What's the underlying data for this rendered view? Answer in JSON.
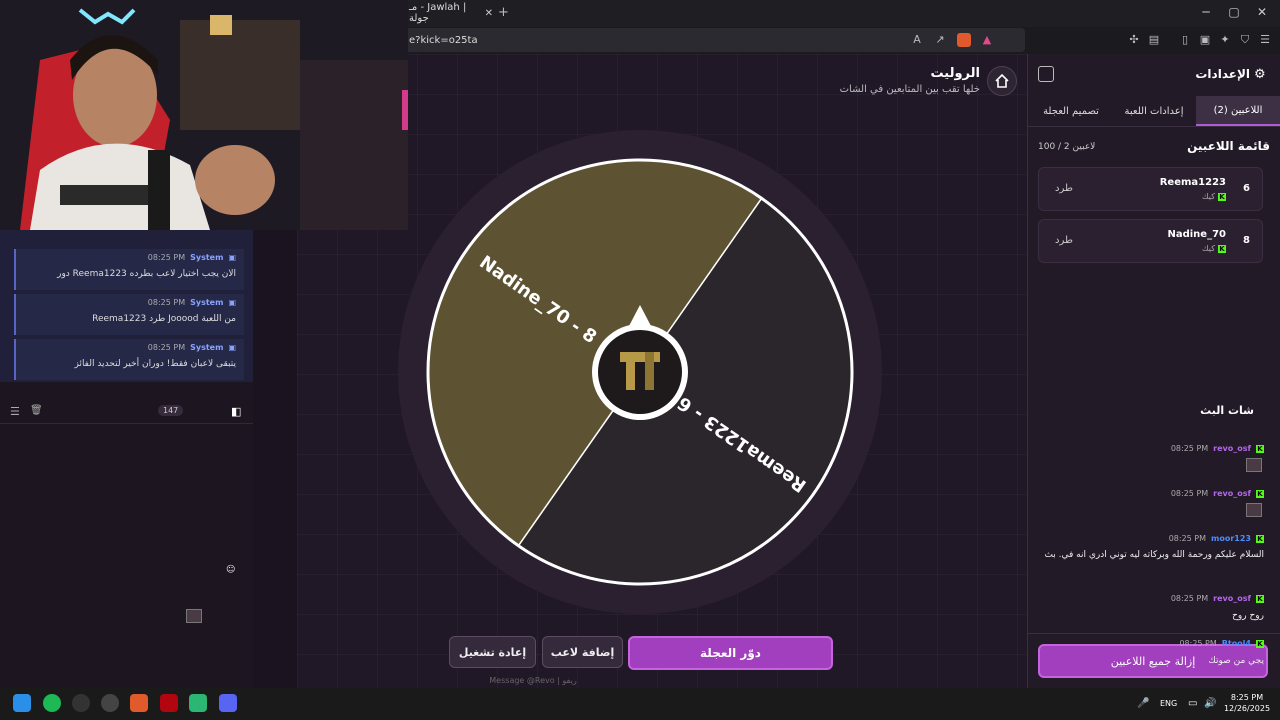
{
  "browser": {
    "tab_title": "مـ - Jawlah | جولة",
    "url": "e?kick=o25ta",
    "new_tab": "+",
    "minimize": "─",
    "maximize": "▢",
    "close": "✕",
    "tab_close": "✕"
  },
  "header": {
    "title": "الروليت",
    "subtitle": "خلها تقب بين المتابعين في الشات",
    "home_icon": "home-icon"
  },
  "wheel": {
    "segments": [
      {
        "label": "Reema1223 - 6",
        "value": 1,
        "color": "#2b252c"
      },
      {
        "label": "Nadine_70 - 8",
        "value": 1,
        "color": "#5d5232"
      }
    ],
    "start_angle_deg": -55
  },
  "actions": {
    "spin": "دوّر العجلة",
    "add_player": "إضافة لاعب",
    "restart": "إعادة تشغيل"
  },
  "settings": {
    "title": "الإعدادات",
    "tabs": [
      "اللاعبين (2)",
      "إعدادات اللعبة",
      "تصميم العجلة"
    ],
    "list_title": "قائمة اللاعبين",
    "count": "100 / 2 لاعبين",
    "players": [
      {
        "num": "6",
        "name": "Reema1223",
        "platform": "كيك",
        "kick": "طرد"
      },
      {
        "num": "8",
        "name": "Nadine_70",
        "platform": "كيك",
        "kick": "طرد"
      }
    ],
    "remove_all": "إزالة جميع اللاعبين"
  },
  "system_messages": [
    {
      "name": "System",
      "time": "08:25 PM",
      "text": "دور Reema1223 الان يجب اختيار لاعب بطرده"
    },
    {
      "name": "System",
      "time": "08:25 PM",
      "text": "Reema1223 طرد Jooood من اللعبة"
    },
    {
      "name": "System",
      "time": "08:25 PM",
      "text": "يتبقى لاعبان فقط! دوران أخير لتحديد الفائز"
    }
  ],
  "chat": {
    "title": "شات البث",
    "count": "147",
    "messages": [
      {
        "user": "revo_osf",
        "time": "08:25 PM",
        "text": "",
        "color": "#b368e8"
      },
      {
        "user": "revo_osf",
        "time": "08:25 PM",
        "text": "",
        "color": "#b368e8"
      },
      {
        "user": "moor123",
        "time": "08:25 PM",
        "text": "السلام عليكم ورحمة الله وبركاته ليه توني ادري انه في. بث",
        "color": "#4a8dff"
      },
      {
        "user": "revo_osf",
        "time": "08:25 PM",
        "text": "روح روح",
        "color": "#b368e8"
      },
      {
        "user": "Btool4",
        "time": "08:25 PM",
        "text": "يجي من صوتك",
        "color": "#4a8dff"
      }
    ],
    "input_placeholder": "Message @Revo | ريفو"
  },
  "taskbar": {
    "lang": "ENG",
    "time": "8:25 PM",
    "date": "12/26/2025"
  }
}
